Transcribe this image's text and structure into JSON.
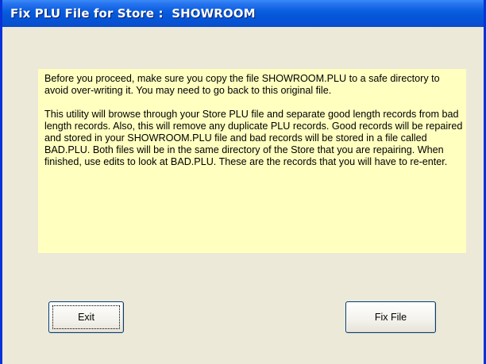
{
  "window": {
    "title": "Fix PLU File for Store :  SHOWROOM"
  },
  "message": {
    "paragraph1": "Before you proceed, make sure you copy the file SHOWROOM.PLU to a safe directory to avoid over-writing it.  You may need to go back to this original file.",
    "paragraph2": "This utility will browse through your Store PLU file and separate good length records from bad length records.  Also, this will remove any duplicate PLU records.  Good records will be repaired and stored in your SHOWROOM.PLU file and bad records will be stored in a file called BAD.PLU.  Both files will be in the same directory of the Store that you are repairing.  When finished, use edits to look at BAD.PLU.  These are the records that you will have to re-enter."
  },
  "buttons": {
    "exit_label": "Exit",
    "fix_label": "Fix File"
  },
  "colors": {
    "titlebar": "#0556d8",
    "frame": "#0831d9",
    "background": "#ece9d8",
    "message_background": "#ffffc0"
  }
}
